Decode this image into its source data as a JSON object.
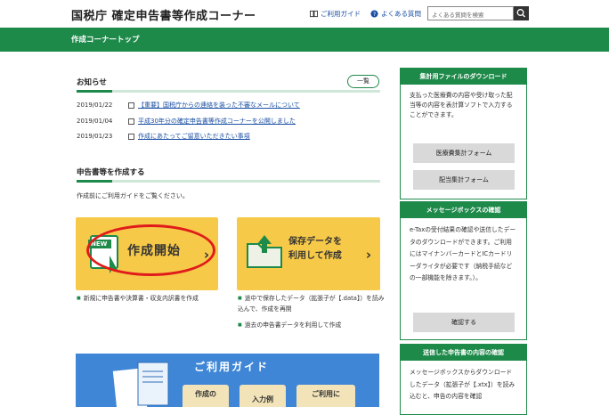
{
  "header": {
    "site_title": "国税庁 確定申告書等作成コーナー",
    "usage_guide": "ご利用ガイド",
    "faq": "よくある質問",
    "search_placeholder": "よくある質問を検索"
  },
  "nav": {
    "breadcrumb": "作成コーナートップ"
  },
  "news": {
    "title": "お知らせ",
    "list_button": "一覧",
    "items": [
      {
        "date": "2019/01/22",
        "text": "【重要】国税庁からの連絡を装った不審なメールについて"
      },
      {
        "date": "2019/01/04",
        "text": "平成30年分の確定申告書等作成コーナーを公開しました"
      },
      {
        "date": "2019/01/23",
        "text": "作成にあたってご留意いただきたい事項"
      }
    ]
  },
  "create": {
    "title": "申告書等を作成する",
    "guide": "作成前にご利用ガイドをご覧ください。",
    "start_button": {
      "badge": "NEW",
      "label": "作成開始"
    },
    "saved_button": {
      "line1": "保存データを",
      "line2": "利用して作成"
    },
    "bullets_left": [
      "新規に申告書や決算書・収支内訳書を作成"
    ],
    "bullets_right": [
      "途中で保存したデータ（拡張子が【.data】）を読み込んで、作成を再開",
      "過去の申告書データを利用して作成"
    ]
  },
  "guide_banner": {
    "title": "ご利用ガイド",
    "buttons": [
      {
        "line1": "作成の",
        "line2": ""
      },
      {
        "line1": "入力例",
        "line2": ""
      },
      {
        "line1": "ご利用に",
        "line2": ""
      }
    ]
  },
  "sidebar": {
    "download": {
      "title": "集計用ファイルのダウンロード",
      "text": "支払った医療費の内容や受け取った配当等の内容を表計算ソフトで入力することができます。",
      "buttons": [
        "医療費集計フォーム",
        "配当集計フォーム"
      ]
    },
    "messagebox": {
      "title": "メッセージボックスの確認",
      "text": "e-Taxの受付結果の確認や送信したデータのダウンロードができます。ご利用にはマイナンバーカードとICカードリーダライタが必要です（納税手続などの一部機能を除きます。）。",
      "button": "確認する"
    },
    "sent": {
      "title": "送信した申告書の内容の確認",
      "text": "メッセージボックスからダウンロードしたデータ（拡張子が【.xtx】）を読み込むと、申告の内容を確認"
    }
  },
  "colors": {
    "brand_green": "#1e8a4a",
    "button_yellow": "#f7c948",
    "highlight_red": "#e01b1b",
    "guide_blue": "#3f86d6"
  }
}
